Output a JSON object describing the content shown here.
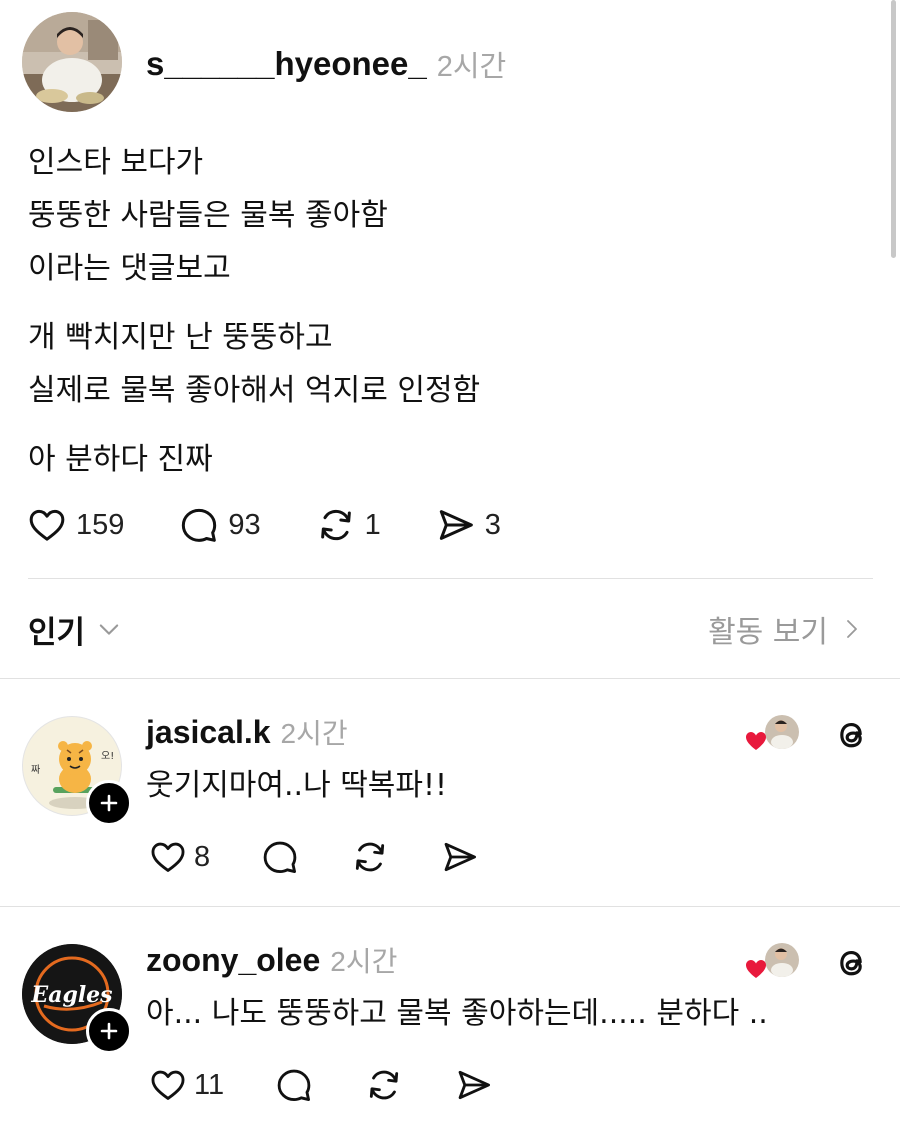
{
  "post": {
    "username": "s______hyeonee_",
    "time": "2시간",
    "paragraphs": [
      [
        "인스타 보다가",
        "뚱뚱한 사람들은 물복 좋아함",
        "이라는 댓글보고"
      ],
      [
        "개 빡치지만 난 뚱뚱하고",
        "실제로 물복 좋아해서 억지로 인정함"
      ],
      [
        "아 분하다 진짜"
      ]
    ],
    "likes": "159",
    "replies": "93",
    "reposts": "1",
    "shares": "3"
  },
  "sort": {
    "label": "인기",
    "activity_label": "활동 보기"
  },
  "comments": [
    {
      "username": "jasical.k",
      "time": "2시간",
      "text": "웃기지마여..나 딱복파!!",
      "likes": "8",
      "avatar_text": "짜오"
    },
    {
      "username": "zoony_olee",
      "time": "2시간",
      "text": "아... 나도 뚱뚱하고 물복 좋아하는데..... 분하다 ..",
      "likes": "11",
      "avatar_text": "Eagles"
    }
  ],
  "colors": {
    "heart_red": "#e8193c",
    "muted_text": "#a7a7a7",
    "divider": "#e1e1e1"
  },
  "icons": [
    "heart-icon",
    "comment-icon",
    "repost-icon",
    "share-icon",
    "chevron-down-icon",
    "chevron-right-icon",
    "threads-icon",
    "plus-icon"
  ]
}
